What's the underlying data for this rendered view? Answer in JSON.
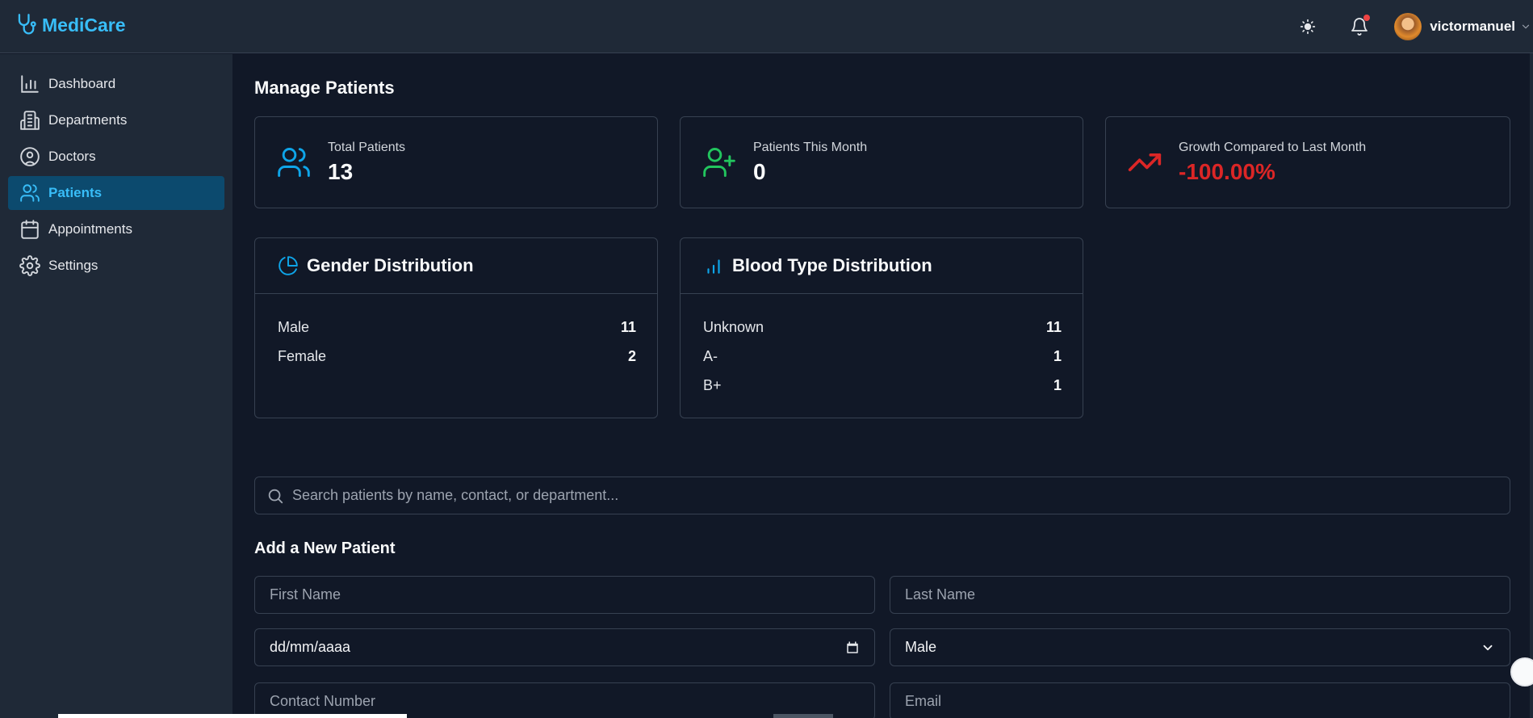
{
  "app": {
    "name": "MediCare"
  },
  "header": {
    "username": "victormanuel"
  },
  "sidebar": {
    "items": [
      {
        "label": "Dashboard",
        "icon": "bar-chart-icon"
      },
      {
        "label": "Departments",
        "icon": "building-icon"
      },
      {
        "label": "Doctors",
        "icon": "user-circle-icon"
      },
      {
        "label": "Patients",
        "icon": "users-icon",
        "active": true
      },
      {
        "label": "Appointments",
        "icon": "calendar-icon"
      },
      {
        "label": "Settings",
        "icon": "gear-icon"
      }
    ]
  },
  "page": {
    "title": "Manage Patients"
  },
  "stats": [
    {
      "label": "Total Patients",
      "value": "13",
      "icon": "users-icon",
      "color": "#0ea5e9"
    },
    {
      "label": "Patients This Month",
      "value": "0",
      "icon": "user-plus-icon",
      "color": "#22c55e"
    },
    {
      "label": "Growth Compared to Last Month",
      "value": "-100.00%",
      "icon": "trending-up-icon",
      "color": "#dc2626"
    }
  ],
  "gender": {
    "title": "Gender Distribution",
    "rows": [
      {
        "label": "Male",
        "value": "11"
      },
      {
        "label": "Female",
        "value": "2"
      }
    ]
  },
  "blood": {
    "title": "Blood Type Distribution",
    "rows": [
      {
        "label": "Unknown",
        "value": "11"
      },
      {
        "label": "A-",
        "value": "1"
      },
      {
        "label": "B+",
        "value": "1"
      }
    ]
  },
  "search": {
    "placeholder": "Search patients by name, contact, or department..."
  },
  "form": {
    "title": "Add a New Patient",
    "first_name_placeholder": "First Name",
    "last_name_placeholder": "Last Name",
    "date_placeholder": "dd/mm/aaaa",
    "gender_value": "Male",
    "contact_placeholder": "Contact Number",
    "email_placeholder": "Email"
  },
  "colors": {
    "accent": "#38bdf8",
    "active_bg": "#0c4a6e",
    "danger": "#dc2626",
    "success": "#22c55e"
  }
}
